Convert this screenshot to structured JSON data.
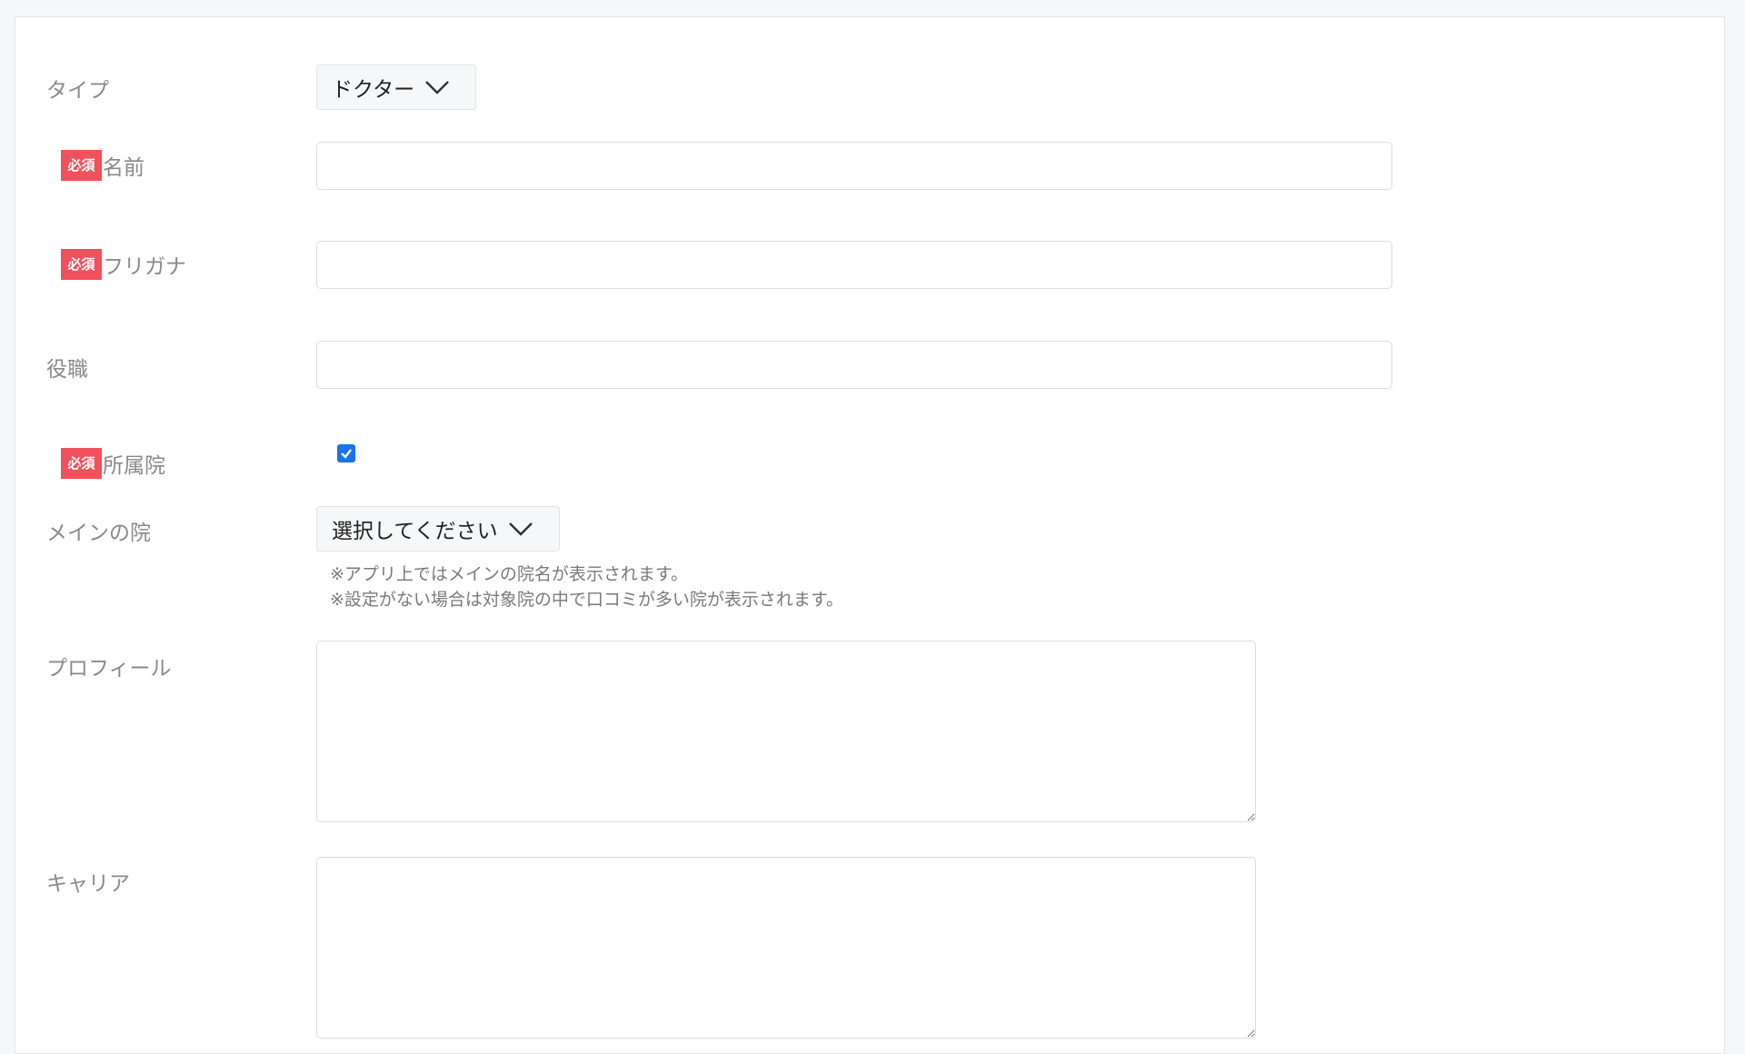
{
  "form": {
    "type": {
      "label": "タイプ",
      "value": "ドクター"
    },
    "name": {
      "required_badge": "必須",
      "label": "名前",
      "value": ""
    },
    "furigana": {
      "required_badge": "必須",
      "label": "フリガナ",
      "value": ""
    },
    "position": {
      "label": "役職",
      "value": ""
    },
    "clinic": {
      "required_badge": "必須",
      "label": "所属院",
      "checked": true
    },
    "main_clinic": {
      "label": "メインの院",
      "value": "選択してください",
      "notes": [
        "※アプリ上ではメインの院名が表示されます。",
        "※設定がない場合は対象院の中で口コミが多い院が表示されます。"
      ]
    },
    "profile": {
      "label": "プロフィール",
      "value": ""
    },
    "career": {
      "label": "キャリア",
      "value": ""
    }
  },
  "colors": {
    "required_badge": "#f0515a",
    "checkbox": "#1a73e8",
    "label_text": "#8a8a8a"
  }
}
